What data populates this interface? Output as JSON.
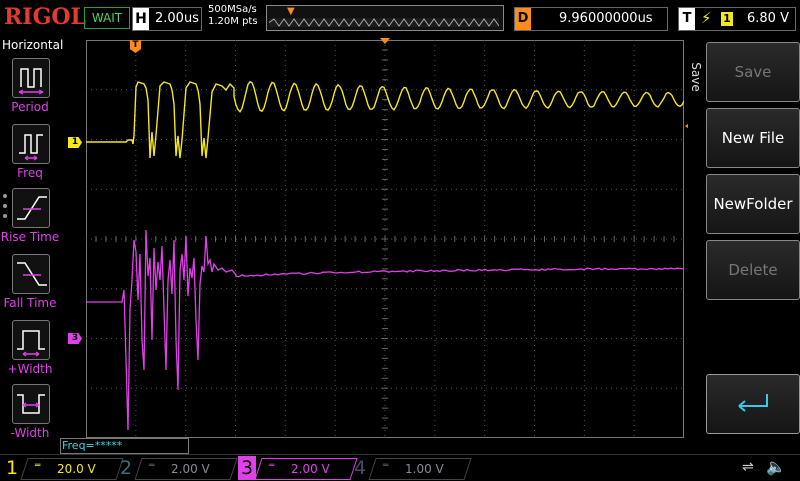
{
  "topbar": {
    "logo": "RIGOL",
    "status": "WAIT",
    "horizontal": {
      "label": "H",
      "value": "2.00us"
    },
    "sample_rate": "500MSa/s",
    "memory_depth": "1.20M pts",
    "delay": {
      "label": "D",
      "value": "9.96000000us"
    },
    "trigger": {
      "label": "T",
      "source": "1",
      "level": "6.80 V"
    }
  },
  "left_panel": {
    "title": "Horizontal",
    "items": [
      {
        "label": "Period",
        "icon": "period-icon"
      },
      {
        "label": "Freq",
        "icon": "freq-icon"
      },
      {
        "label": "Rise Time",
        "icon": "rise-time-icon"
      },
      {
        "label": "Fall Time",
        "icon": "fall-time-icon"
      },
      {
        "label": "+Width",
        "icon": "positive-width-icon"
      },
      {
        "label": "-Width",
        "icon": "negative-width-icon"
      }
    ]
  },
  "right_panel": {
    "tab": "Save",
    "buttons": [
      {
        "label": "Save",
        "enabled": false
      },
      {
        "label": "New File",
        "enabled": true
      },
      {
        "label": "NewFolder",
        "enabled": true
      },
      {
        "label": "Delete",
        "enabled": false
      },
      {
        "label": "",
        "icon": "return-arrow-icon",
        "enabled": true
      }
    ]
  },
  "freq_readout": "Freq=*****",
  "markers": {
    "ch1": "1",
    "ch3": "3",
    "trigger": "T"
  },
  "channels": [
    {
      "num": "1",
      "scale": "20.0 V",
      "color": "#f4e81b",
      "active": true
    },
    {
      "num": "2",
      "scale": "2.00 V",
      "color": "#3fa0c0",
      "active": false
    },
    {
      "num": "3",
      "scale": "2.00 V",
      "color": "#e040e8",
      "active": true
    },
    {
      "num": "4",
      "scale": "1.00 V",
      "color": "#4b6fd6",
      "active": false
    }
  ],
  "colors": {
    "ch1": "#f4e81b",
    "ch3": "#e040e8",
    "trigger": "#ff8c1a",
    "grid": "#555555"
  }
}
